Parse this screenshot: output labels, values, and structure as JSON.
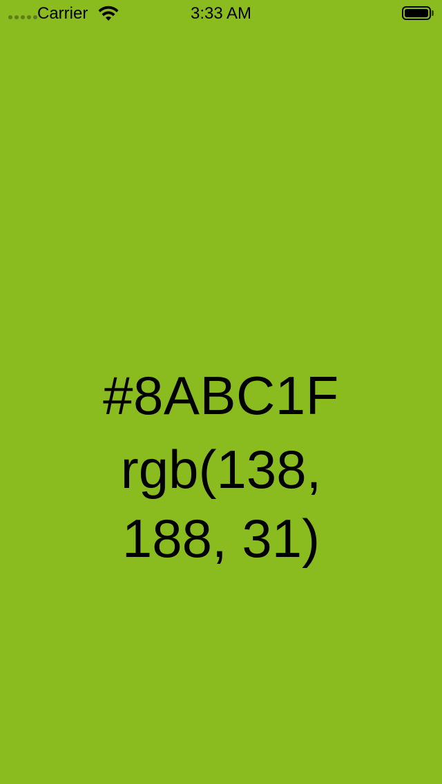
{
  "status_bar": {
    "carrier": "Carrier",
    "time": "3:33 AM",
    "battery_level": 1.0
  },
  "color": {
    "hex": "#8ABC1F",
    "rgb": "rgb(138, 188, 31)",
    "background": "#8ABC1F"
  }
}
